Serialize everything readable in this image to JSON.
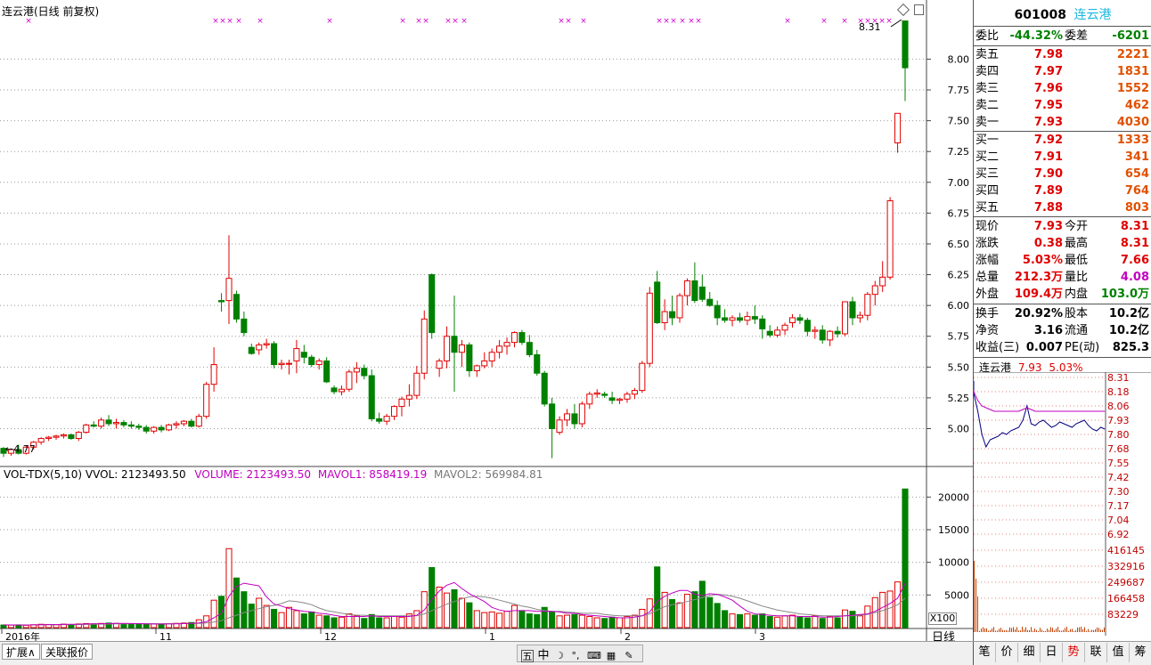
{
  "chart_title": "连云港(日线 前复权)",
  "low_label": "4.77",
  "high_label": "8.31",
  "price_axis": [
    "8.00",
    "7.75",
    "7.50",
    "7.25",
    "7.00",
    "6.75",
    "6.50",
    "6.25",
    "6.00",
    "5.75",
    "5.50",
    "5.25",
    "5.00"
  ],
  "vol_header": {
    "name": "VOL-TDX(5,10)",
    "vvol": "VVOL: 2123493.50",
    "volume": "VOLUME: 2123493.50",
    "mavol1": "MAVOL1: 858419.19",
    "mavol2": "MAVOL2: 569984.81"
  },
  "vol_axis": [
    "20000",
    "15000",
    "10000",
    "5000"
  ],
  "vol_unit": "X100",
  "period_label": "日线",
  "date_axis": [
    "2016年",
    "11",
    "12",
    "1",
    "2",
    "3"
  ],
  "quote": {
    "code": "601008",
    "name": "连云港",
    "wb_label": "委比",
    "wb": "-44.32%",
    "wc_label": "委差",
    "wc": "-6201",
    "sells": [
      {
        "l": "卖五",
        "p": "7.98",
        "v": "2221"
      },
      {
        "l": "卖四",
        "p": "7.97",
        "v": "1831"
      },
      {
        "l": "卖三",
        "p": "7.96",
        "v": "1552"
      },
      {
        "l": "卖二",
        "p": "7.95",
        "v": "462"
      },
      {
        "l": "卖一",
        "p": "7.93",
        "v": "4030"
      }
    ],
    "buys": [
      {
        "l": "买一",
        "p": "7.92",
        "v": "1333"
      },
      {
        "l": "买二",
        "p": "7.91",
        "v": "341"
      },
      {
        "l": "买三",
        "p": "7.90",
        "v": "654"
      },
      {
        "l": "买四",
        "p": "7.89",
        "v": "764"
      },
      {
        "l": "买五",
        "p": "7.88",
        "v": "803"
      }
    ],
    "stats": [
      {
        "a": "现价",
        "b": "7.93",
        "c": "今开",
        "d": "8.31",
        "bc": "red",
        "dc": "red"
      },
      {
        "a": "涨跌",
        "b": "0.38",
        "c": "最高",
        "d": "8.31",
        "bc": "red",
        "dc": "red"
      },
      {
        "a": "涨幅",
        "b": "5.03%",
        "c": "最低",
        "d": "7.66",
        "bc": "red",
        "dc": "red"
      },
      {
        "a": "总量",
        "b": "212.3万",
        "c": "量比",
        "d": "4.08",
        "bc": "red",
        "dc": "pur"
      },
      {
        "a": "外盘",
        "b": "109.4万",
        "c": "内盘",
        "d": "103.0万",
        "bc": "red",
        "dc": "grn"
      }
    ],
    "stats2": [
      {
        "a": "换手",
        "b": "20.92%",
        "c": "股本",
        "d": "10.2亿"
      },
      {
        "a": "净资",
        "b": "3.16",
        "c": "流通",
        "d": "10.2亿"
      },
      {
        "a": "收益(三)",
        "b": "0.007",
        "c": "PE(动)",
        "d": "825.3"
      }
    ]
  },
  "mini": {
    "title": "连云港",
    "price": "7.93",
    "pct": "5.03%",
    "price_axis": [
      "8.31",
      "8.18",
      "8.06",
      "7.93",
      "7.80",
      "7.68",
      "7.55",
      "7.42",
      "7.30",
      "7.17",
      "7.04",
      "6.92"
    ],
    "vol_axis": [
      "416145",
      "332916",
      "249687",
      "166458",
      "83229"
    ]
  },
  "bottom": {
    "tab1": "扩展∧",
    "tab2": "关联报价",
    "icons": [
      "五",
      "中",
      "☽",
      "°,",
      "⌨",
      "▦",
      "✎"
    ],
    "rtabs": [
      "笔",
      "价",
      "细",
      "日",
      "势",
      "联",
      "值",
      "筹"
    ]
  },
  "colors": {
    "up": "#e00000",
    "down": "#008000",
    "ma1": "#c000c0",
    "ma2": "#888888",
    "grid": "#999999"
  },
  "chart_data": {
    "type": "candlestick",
    "ohlc": [
      [
        4.84,
        4.85,
        4.77,
        4.8
      ],
      [
        4.8,
        4.84,
        4.78,
        4.83
      ],
      [
        4.83,
        4.87,
        4.79,
        4.8
      ],
      [
        4.8,
        4.86,
        4.79,
        4.85
      ],
      [
        4.85,
        4.9,
        4.83,
        4.89
      ],
      [
        4.89,
        4.93,
        4.87,
        4.92
      ],
      [
        4.92,
        4.94,
        4.9,
        4.93
      ],
      [
        4.93,
        4.95,
        4.91,
        4.94
      ],
      [
        4.94,
        4.96,
        4.92,
        4.95
      ],
      [
        4.95,
        4.96,
        4.91,
        4.92
      ],
      [
        4.92,
        4.98,
        4.9,
        4.97
      ],
      [
        4.97,
        5.04,
        4.96,
        5.03
      ],
      [
        5.03,
        5.06,
        5.01,
        5.02
      ],
      [
        5.02,
        5.09,
        5.0,
        5.07
      ],
      [
        5.07,
        5.11,
        5.02,
        5.04
      ],
      [
        5.04,
        5.08,
        5.0,
        5.05
      ],
      [
        5.05,
        5.07,
        5.01,
        5.03
      ],
      [
        5.03,
        5.06,
        5.0,
        5.02
      ],
      [
        5.02,
        5.04,
        4.99,
        5.01
      ],
      [
        5.01,
        5.03,
        4.96,
        4.98
      ],
      [
        4.98,
        5.02,
        4.96,
        5.01
      ],
      [
        5.01,
        5.03,
        4.97,
        4.99
      ],
      [
        4.99,
        5.04,
        4.98,
        5.03
      ],
      [
        5.03,
        5.06,
        5.0,
        5.04
      ],
      [
        5.04,
        5.07,
        5.02,
        5.06
      ],
      [
        5.06,
        5.08,
        5.01,
        5.02
      ],
      [
        5.02,
        5.12,
        5.01,
        5.1
      ],
      [
        5.1,
        5.38,
        5.08,
        5.36
      ],
      [
        5.36,
        5.66,
        5.3,
        5.52
      ],
      [
        6.04,
        6.1,
        5.95,
        6.03
      ],
      [
        6.04,
        6.57,
        5.85,
        6.22
      ],
      [
        6.09,
        6.12,
        5.86,
        5.89
      ],
      [
        5.89,
        5.95,
        5.75,
        5.78
      ],
      [
        5.66,
        5.69,
        5.6,
        5.61
      ],
      [
        5.64,
        5.7,
        5.6,
        5.68
      ],
      [
        5.68,
        5.73,
        5.65,
        5.69
      ],
      [
        5.69,
        5.71,
        5.49,
        5.52
      ],
      [
        5.52,
        5.56,
        5.48,
        5.53
      ],
      [
        5.53,
        5.56,
        5.44,
        5.53
      ],
      [
        5.55,
        5.72,
        5.45,
        5.65
      ],
      [
        5.62,
        5.68,
        5.53,
        5.58
      ],
      [
        5.58,
        5.6,
        5.5,
        5.52
      ],
      [
        5.52,
        5.57,
        5.48,
        5.55
      ],
      [
        5.55,
        5.58,
        5.37,
        5.38
      ],
      [
        5.33,
        5.35,
        5.28,
        5.3
      ],
      [
        5.3,
        5.35,
        5.27,
        5.32
      ],
      [
        5.32,
        5.48,
        5.3,
        5.46
      ],
      [
        5.46,
        5.54,
        5.37,
        5.49
      ],
      [
        5.49,
        5.52,
        5.4,
        5.43
      ],
      [
        5.43,
        5.48,
        5.06,
        5.08
      ],
      [
        5.08,
        5.13,
        5.04,
        5.06
      ],
      [
        5.06,
        5.12,
        5.03,
        5.1
      ],
      [
        5.1,
        5.19,
        5.07,
        5.18
      ],
      [
        5.18,
        5.26,
        5.1,
        5.24
      ],
      [
        5.24,
        5.36,
        5.18,
        5.27
      ],
      [
        5.27,
        5.51,
        5.24,
        5.45
      ],
      [
        5.45,
        5.96,
        5.4,
        5.89
      ],
      [
        6.25,
        6.26,
        5.73,
        5.78
      ],
      [
        5.49,
        5.57,
        5.42,
        5.55
      ],
      [
        5.55,
        5.83,
        5.49,
        5.75
      ],
      [
        5.75,
        6.08,
        5.3,
        5.62
      ],
      [
        5.62,
        5.72,
        5.5,
        5.68
      ],
      [
        5.68,
        5.7,
        5.42,
        5.47
      ],
      [
        5.47,
        5.52,
        5.42,
        5.51
      ],
      [
        5.51,
        5.62,
        5.49,
        5.55
      ],
      [
        5.55,
        5.65,
        5.5,
        5.62
      ],
      [
        5.62,
        5.72,
        5.57,
        5.67
      ],
      [
        5.67,
        5.74,
        5.6,
        5.7
      ],
      [
        5.7,
        5.79,
        5.66,
        5.78
      ],
      [
        5.78,
        5.8,
        5.68,
        5.7
      ],
      [
        5.7,
        5.76,
        5.58,
        5.6
      ],
      [
        5.6,
        5.64,
        5.43,
        5.45
      ],
      [
        5.45,
        5.47,
        5.18,
        5.2
      ],
      [
        5.2,
        5.25,
        4.76,
        5.0
      ],
      [
        4.97,
        5.1,
        4.95,
        5.07
      ],
      [
        5.07,
        5.16,
        5.02,
        5.12
      ],
      [
        5.12,
        5.2,
        5.0,
        5.04
      ],
      [
        5.04,
        5.22,
        5.01,
        5.2
      ],
      [
        5.2,
        5.3,
        5.16,
        5.28
      ],
      [
        5.28,
        5.32,
        5.25,
        5.29
      ],
      [
        5.28,
        5.3,
        5.25,
        5.27
      ],
      [
        5.25,
        5.3,
        5.2,
        5.23
      ],
      [
        5.23,
        5.25,
        5.2,
        5.24
      ],
      [
        5.24,
        5.3,
        5.21,
        5.28
      ],
      [
        5.28,
        5.33,
        5.24,
        5.31
      ],
      [
        5.31,
        5.55,
        5.29,
        5.53
      ],
      [
        5.53,
        6.15,
        5.5,
        6.1
      ],
      [
        6.19,
        6.28,
        5.85,
        5.86
      ],
      [
        5.86,
        6.05,
        5.8,
        5.95
      ],
      [
        5.95,
        6.08,
        5.84,
        5.9
      ],
      [
        5.9,
        6.1,
        5.86,
        6.08
      ],
      [
        6.08,
        6.22,
        6.0,
        6.2
      ],
      [
        6.2,
        6.35,
        6.02,
        6.04
      ],
      [
        6.15,
        6.25,
        6.03,
        6.05
      ],
      [
        6.05,
        6.11,
        5.99,
        6.0
      ],
      [
        6.0,
        6.04,
        5.84,
        5.9
      ],
      [
        5.9,
        5.97,
        5.86,
        5.88
      ],
      [
        5.88,
        5.92,
        5.83,
        5.9
      ],
      [
        5.9,
        5.94,
        5.86,
        5.88
      ],
      [
        5.88,
        5.95,
        5.84,
        5.91
      ],
      [
        5.91,
        6.0,
        5.85,
        5.89
      ],
      [
        5.89,
        5.92,
        5.73,
        5.81
      ],
      [
        5.79,
        5.84,
        5.74,
        5.76
      ],
      [
        5.76,
        5.83,
        5.74,
        5.8
      ],
      [
        5.8,
        5.86,
        5.76,
        5.84
      ],
      [
        5.86,
        5.93,
        5.82,
        5.9
      ],
      [
        5.9,
        5.93,
        5.85,
        5.88
      ],
      [
        5.88,
        5.9,
        5.75,
        5.79
      ],
      [
        5.79,
        5.83,
        5.73,
        5.8
      ],
      [
        5.8,
        5.84,
        5.69,
        5.72
      ],
      [
        5.72,
        5.8,
        5.67,
        5.79
      ],
      [
        5.79,
        5.83,
        5.74,
        5.77
      ],
      [
        5.77,
        6.03,
        5.75,
        6.03
      ],
      [
        6.03,
        6.07,
        5.84,
        5.9
      ],
      [
        5.9,
        5.95,
        5.86,
        5.92
      ],
      [
        5.92,
        6.11,
        5.88,
        6.09
      ],
      [
        6.09,
        6.2,
        6.0,
        6.16
      ],
      [
        6.16,
        6.36,
        6.11,
        6.23
      ],
      [
        6.23,
        6.88,
        6.21,
        6.85
      ],
      [
        7.32,
        7.56,
        7.24,
        7.56
      ],
      [
        8.31,
        8.31,
        7.66,
        7.93
      ]
    ],
    "volume": [
      400,
      380,
      420,
      360,
      440,
      510,
      480,
      450,
      530,
      470,
      560,
      620,
      580,
      640,
      700,
      650,
      590,
      530,
      520,
      480,
      560,
      540,
      600,
      650,
      700,
      780,
      1200,
      1800,
      4200,
      4800,
      12100,
      7600,
      5500,
      3600,
      4500,
      3400,
      2800,
      2300,
      3100,
      2600,
      2100,
      2400,
      1900,
      1800,
      1500,
      1600,
      2100,
      1800,
      1400,
      2000,
      1500,
      1500,
      1700,
      1600,
      2100,
      2600,
      5500,
      9200,
      6200,
      5300,
      5800,
      4500,
      3800,
      2600,
      2300,
      2400,
      2200,
      2500,
      3400,
      2600,
      2100,
      2000,
      3100,
      2400,
      1800,
      1900,
      2000,
      1900,
      1700,
      1500,
      1400,
      1600,
      1500,
      1700,
      1900,
      2800,
      4400,
      9300,
      5400,
      4300,
      3800,
      5100,
      5500,
      7100,
      4600,
      3700,
      2600,
      2100,
      2000,
      2100,
      1900,
      2100,
      1700,
      1600,
      1800,
      1900,
      1600,
      1500,
      1800,
      1400,
      1700,
      1500,
      2700,
      2500,
      1800,
      3300,
      4600,
      5400,
      5600,
      7000,
      21235
    ],
    "ma1": [
      420,
      410,
      405,
      400,
      420,
      430,
      460,
      470,
      490,
      510,
      520,
      560,
      580,
      600,
      620,
      640,
      650,
      630,
      610,
      580,
      560,
      550,
      560,
      590,
      620,
      660,
      720,
      880,
      1500,
      2200,
      4800,
      6300,
      6800,
      6600,
      6400,
      4700,
      3600,
      3300,
      2900,
      2700,
      2500,
      2400,
      2200,
      2100,
      1900,
      1700,
      1700,
      1700,
      1700,
      1800,
      1700,
      1700,
      1700,
      1700,
      1700,
      1900,
      2700,
      4300,
      5600,
      6500,
      6900,
      6000,
      5200,
      4600,
      4000,
      3100,
      2700,
      2500,
      2600,
      2600,
      2600,
      2500,
      2500,
      2500,
      2400,
      2200,
      2200,
      2000,
      1900,
      1800,
      1700,
      1600,
      1500,
      1500,
      1600,
      1800,
      2400,
      4000,
      4800,
      5300,
      5700,
      5700,
      5100,
      4900,
      5200,
      5100,
      4700,
      4200,
      3300,
      2500,
      2100,
      2000,
      1900,
      1800,
      1800,
      1800,
      1700,
      1700,
      1700,
      1600,
      1600,
      1700,
      1800,
      1900,
      2000,
      2100,
      2500,
      3100,
      3700,
      4500,
      6800
    ],
    "ma2": [
      410,
      410,
      410,
      405,
      410,
      420,
      430,
      440,
      450,
      460,
      470,
      490,
      510,
      530,
      550,
      570,
      590,
      600,
      600,
      600,
      600,
      600,
      610,
      620,
      630,
      640,
      660,
      710,
      860,
      1060,
      1500,
      1900,
      2300,
      2600,
      2900,
      3200,
      3400,
      3700,
      4100,
      4000,
      3800,
      3500,
      3000,
      2600,
      2400,
      2200,
      2000,
      1900,
      1900,
      1800,
      1800,
      1800,
      1800,
      1800,
      1800,
      1800,
      2100,
      2600,
      3100,
      3600,
      4000,
      4400,
      4700,
      4800,
      4700,
      4500,
      4200,
      3900,
      3600,
      3300,
      3100,
      2800,
      2600,
      2500,
      2500,
      2400,
      2300,
      2200,
      2200,
      2200,
      2000,
      1900,
      1800,
      1800,
      1800,
      1800,
      2100,
      2700,
      3200,
      3500,
      3700,
      4000,
      4300,
      4600,
      4900,
      5100,
      5000,
      4800,
      4500,
      4100,
      3700,
      3300,
      3000,
      2700,
      2500,
      2300,
      2100,
      2000,
      1900,
      1800,
      1800,
      1800,
      1800,
      1800,
      1900,
      2000,
      2300,
      2600,
      3000,
      3500,
      4500
    ],
    "price_range": [
      4.7,
      8.35
    ],
    "vol_range": [
      0,
      22500
    ]
  }
}
